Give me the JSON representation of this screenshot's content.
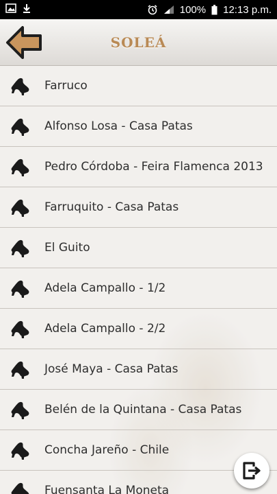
{
  "status_bar": {
    "battery": "100%",
    "time": "12:13 p.m."
  },
  "header": {
    "title": "SOLEÁ",
    "back_icon": "back-arrow-icon"
  },
  "list": {
    "items": [
      {
        "label": "Farruco"
      },
      {
        "label": "Alfonso Losa - Casa Patas"
      },
      {
        "label": "Pedro Córdoba - Feira Flamenca 2013"
      },
      {
        "label": "Farruquito - Casa Patas"
      },
      {
        "label": "El Guito"
      },
      {
        "label": "Adela Campallo - 1/2"
      },
      {
        "label": "Adela Campallo - 2/2"
      },
      {
        "label": "José Maya - Casa Patas"
      },
      {
        "label": "Belén de la Quintana - Casa Patas"
      },
      {
        "label": "Concha Jareño - Chile"
      },
      {
        "label": "Fuensanta La Moneta"
      }
    ]
  },
  "fab": {
    "icon": "exit-icon"
  },
  "colors": {
    "title": "#b98a55",
    "back_arrow": "#c9955d",
    "icon": "#1a1a1a"
  }
}
